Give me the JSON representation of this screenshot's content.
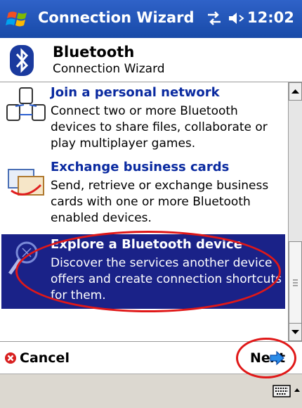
{
  "titlebar": {
    "title": "Connection Wizard",
    "time": "12:02",
    "icons": [
      "windows-start-icon",
      "connectivity-icon",
      "volume-icon"
    ]
  },
  "header": {
    "title": "Bluetooth",
    "subtitle": "Connection Wizard",
    "icon": "bluetooth-icon"
  },
  "options": [
    {
      "title": "Join a personal network",
      "description": "Connect two or more Bluetooth devices to share files, collaborate or play multiplayer games.",
      "icon": "personal-network-icon",
      "selected": false
    },
    {
      "title": "Exchange business cards",
      "description": "Send, retrieve or exchange business cards with one or more Bluetooth enabled devices.",
      "icon": "business-cards-icon",
      "selected": false
    },
    {
      "title": "Explore a Bluetooth device",
      "description": "Discover the services another device offers and create connection shortcuts for them.",
      "icon": "explore-device-icon",
      "selected": true
    }
  ],
  "buttons": {
    "cancel": "Cancel",
    "next": "Next"
  },
  "colors": {
    "titlebar": "#184aa8",
    "selection": "#1a2288",
    "link": "#0a2aa0",
    "annotation": "#e01818"
  }
}
